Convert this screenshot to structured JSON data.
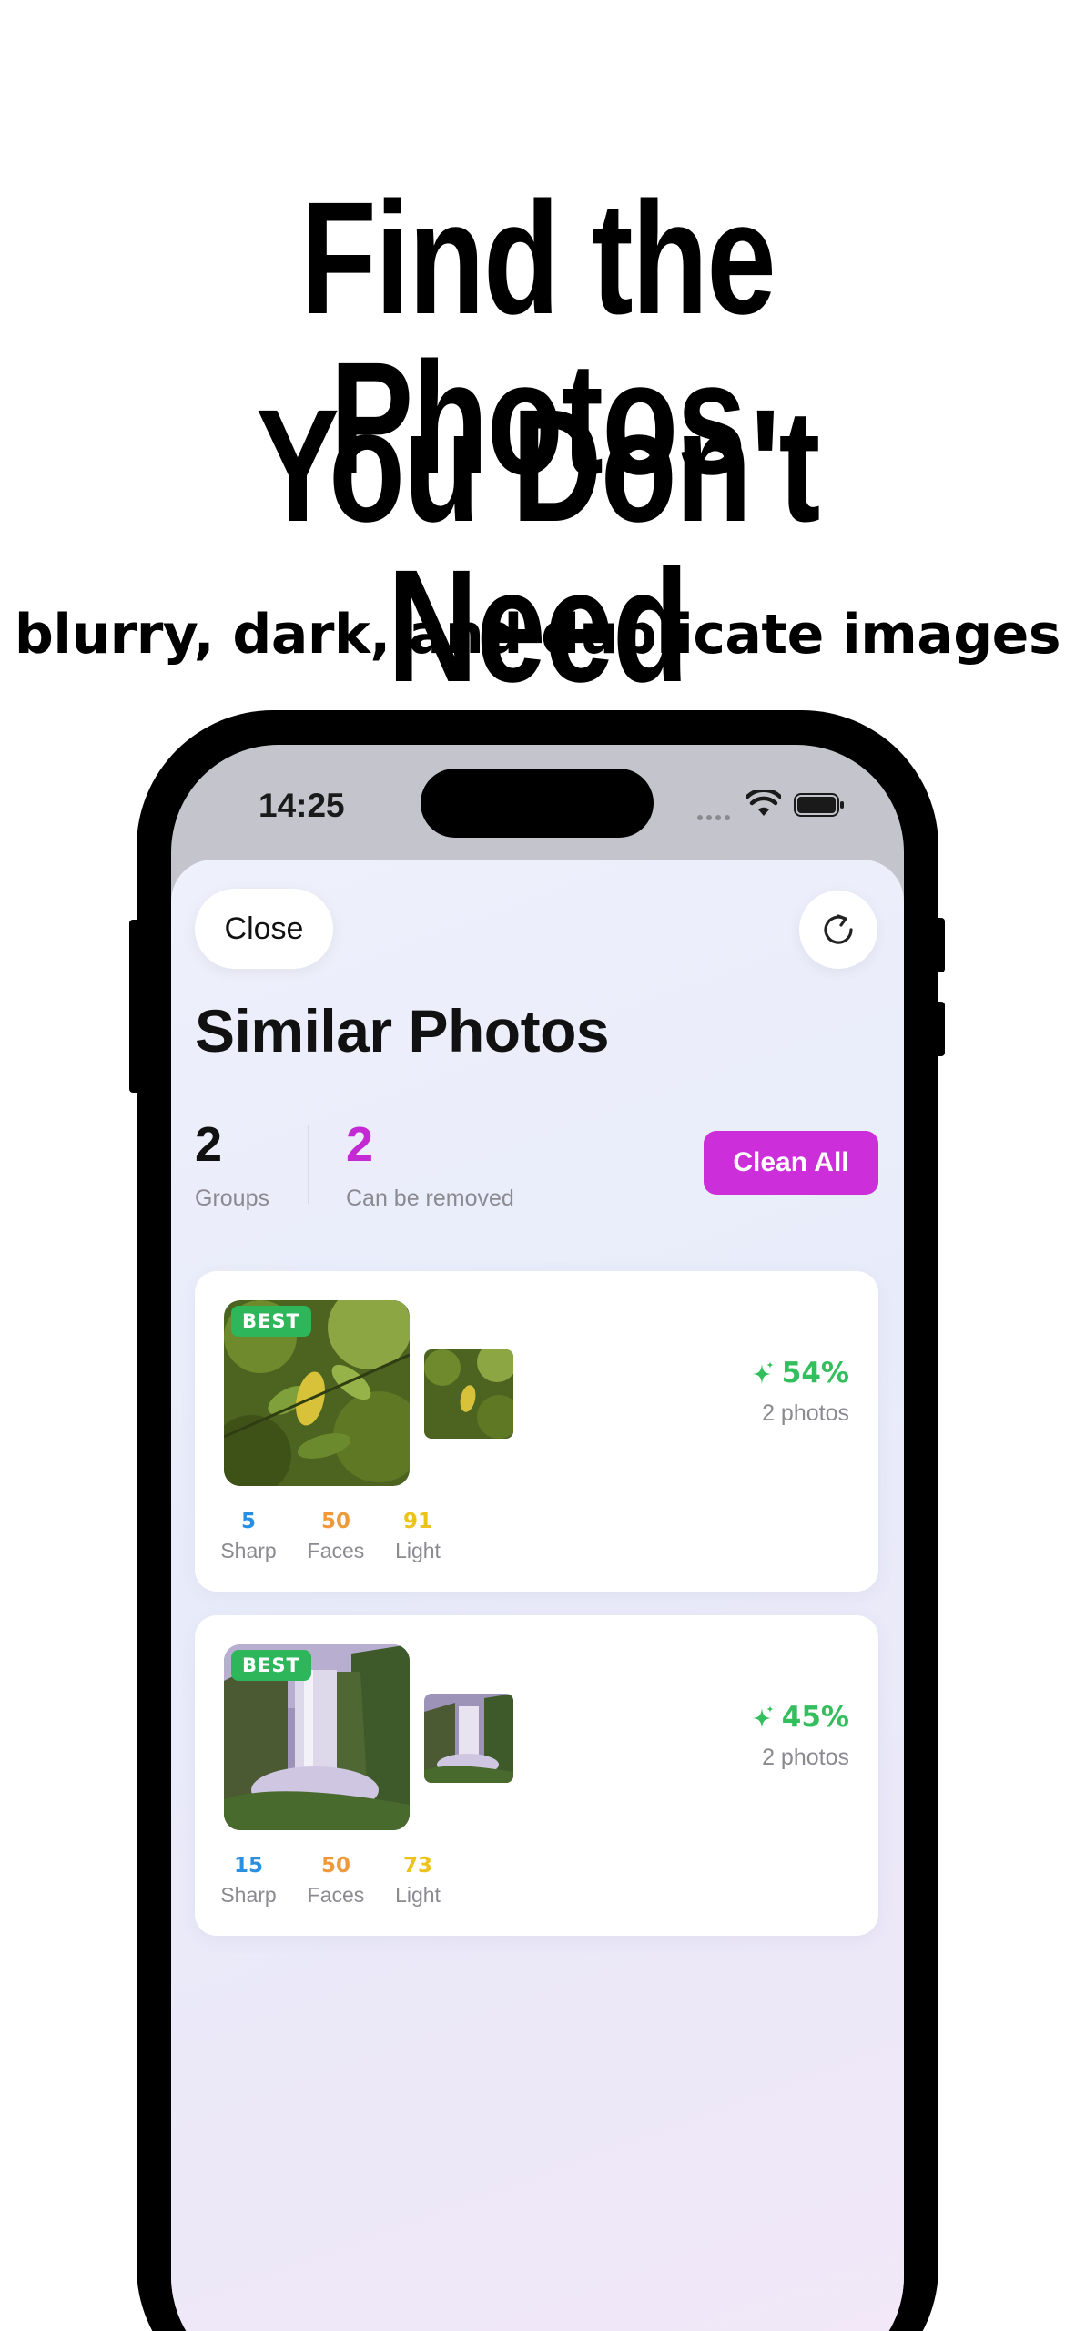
{
  "promo": {
    "headline_line1": "Find the Photos",
    "headline_line2": "You Don't Need",
    "subheadline": "blurry, dark, and duplicate images"
  },
  "status_bar": {
    "time": "14:25"
  },
  "header": {
    "close_label": "Close",
    "refresh_icon": "refresh-icon",
    "title": "Similar Photos"
  },
  "summary": {
    "groups_value": "2",
    "groups_label": "Groups",
    "removable_value": "2",
    "removable_label": "Can be removed",
    "clean_all_label": "Clean All"
  },
  "groups": [
    {
      "badge": "BEST",
      "score": "54%",
      "photo_count": "2 photos",
      "metrics": [
        {
          "value": "5",
          "label": "Sharp"
        },
        {
          "value": "50",
          "label": "Faces"
        },
        {
          "value": "91",
          "label": "Light"
        }
      ]
    },
    {
      "badge": "BEST",
      "score": "45%",
      "photo_count": "2 photos",
      "metrics": [
        {
          "value": "15",
          "label": "Sharp"
        },
        {
          "value": "50",
          "label": "Faces"
        },
        {
          "value": "73",
          "label": "Light"
        }
      ]
    }
  ],
  "colors": {
    "accent": "#cc2fd9",
    "best_badge": "#2db65a",
    "score": "#34bf5e",
    "sharp": "#2b8fe0",
    "faces": "#ef9a3a",
    "light": "#ecc31b"
  }
}
